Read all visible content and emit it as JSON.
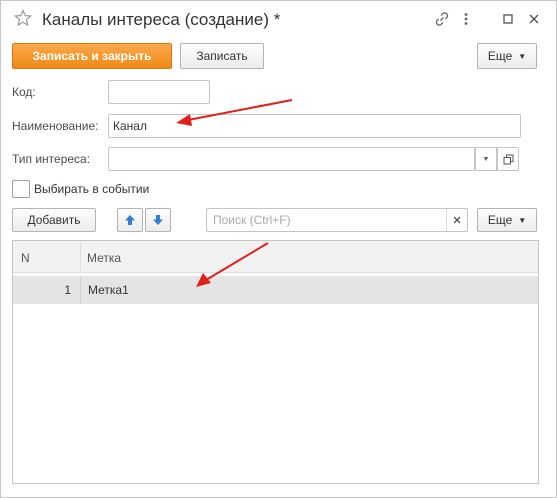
{
  "window": {
    "title": "Каналы интереса (создание) *",
    "icons": [
      "star-icon",
      "link-icon",
      "more-icon",
      "maximize-icon",
      "close-icon"
    ]
  },
  "toolbar": {
    "save_close_label": "Записать и закрыть",
    "save_label": "Записать",
    "more_label": "Еще"
  },
  "form": {
    "code_label": "Код:",
    "code_value": "",
    "name_label": "Наименование:",
    "name_value": "Канал",
    "interest_type_label": "Тип интереса:",
    "interest_type_value": "",
    "choose_in_event_label": "Выбирать в событии",
    "choose_in_event_checked": false
  },
  "table_toolbar": {
    "add_label": "Добавить",
    "search_placeholder": "Поиск (Ctrl+F)",
    "more_label": "Еще"
  },
  "table": {
    "columns": [
      "N",
      "Метка"
    ],
    "rows": [
      {
        "n": "1",
        "label": "Метка1"
      }
    ]
  },
  "colors": {
    "accent": "#f08a17",
    "annotation_arrow": "#e0201b",
    "nav_arrow": "#2f7fd1"
  }
}
